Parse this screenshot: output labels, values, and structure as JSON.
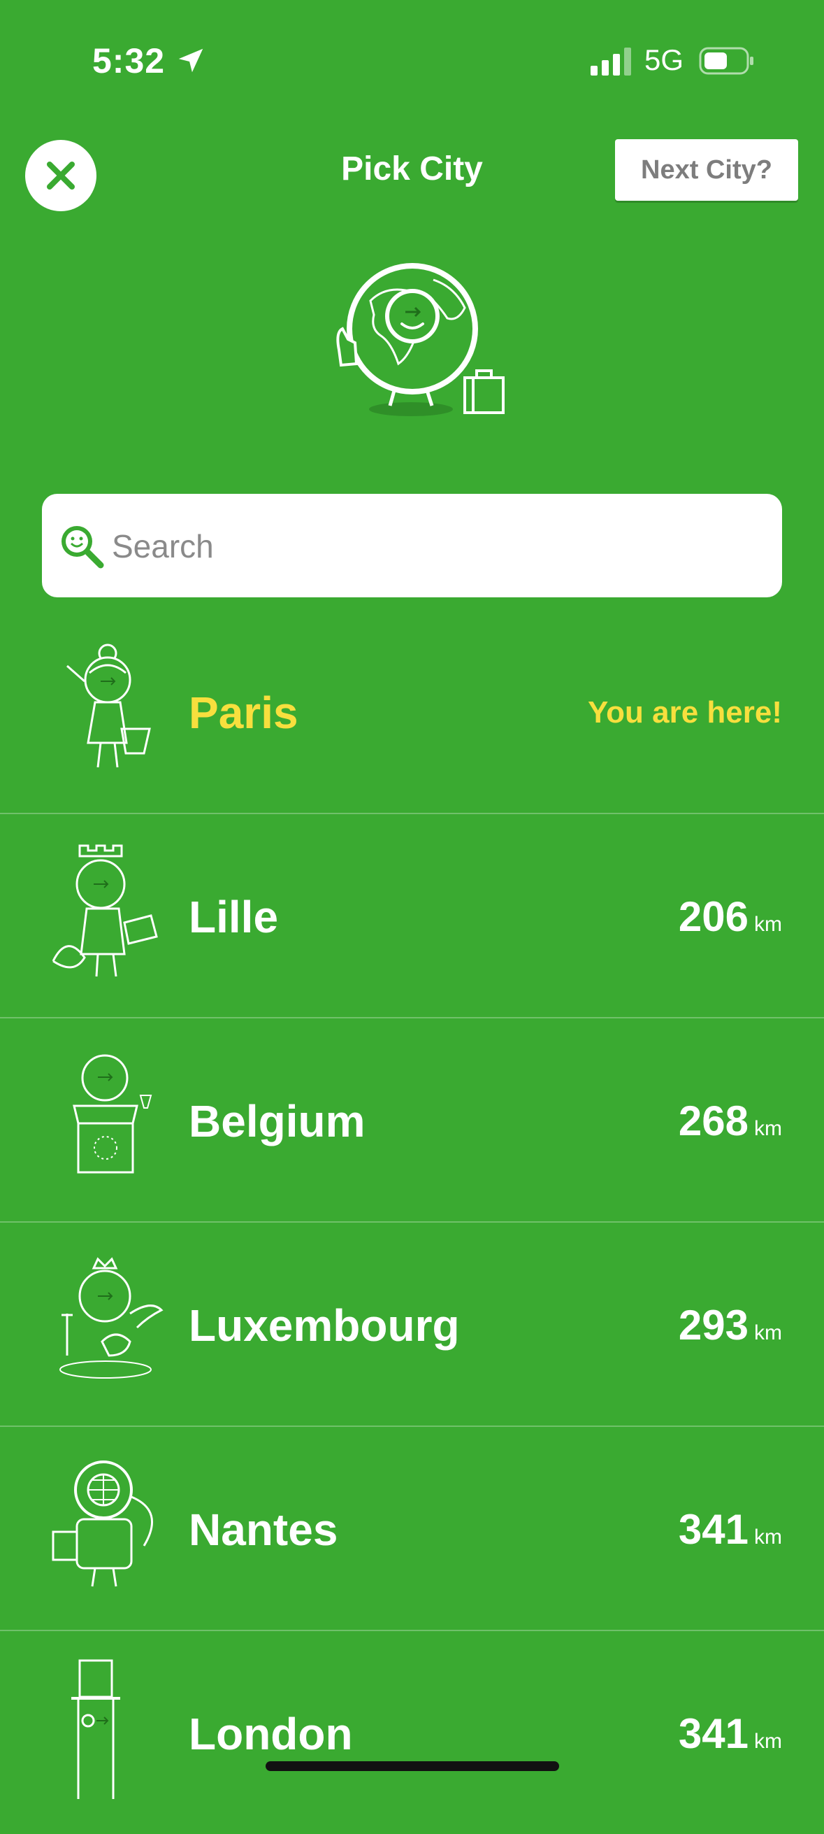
{
  "status_bar": {
    "time": "5:32",
    "network": "5G"
  },
  "header": {
    "title": "Pick City",
    "next_label": "Next City?"
  },
  "search": {
    "placeholder": "Search",
    "value": ""
  },
  "cities": [
    {
      "name": "Paris",
      "note": "You are here!",
      "current": true
    },
    {
      "name": "Lille",
      "distance": "206",
      "unit": "km"
    },
    {
      "name": "Belgium",
      "distance": "268",
      "unit": "km"
    },
    {
      "name": "Luxembourg",
      "distance": "293",
      "unit": "km"
    },
    {
      "name": "Nantes",
      "distance": "341",
      "unit": "km"
    },
    {
      "name": "London",
      "distance": "341",
      "unit": "km"
    }
  ],
  "colors": {
    "background": "#3aaa31",
    "current_highlight": "#f7df3e",
    "button_text": "#7d7d7d"
  }
}
